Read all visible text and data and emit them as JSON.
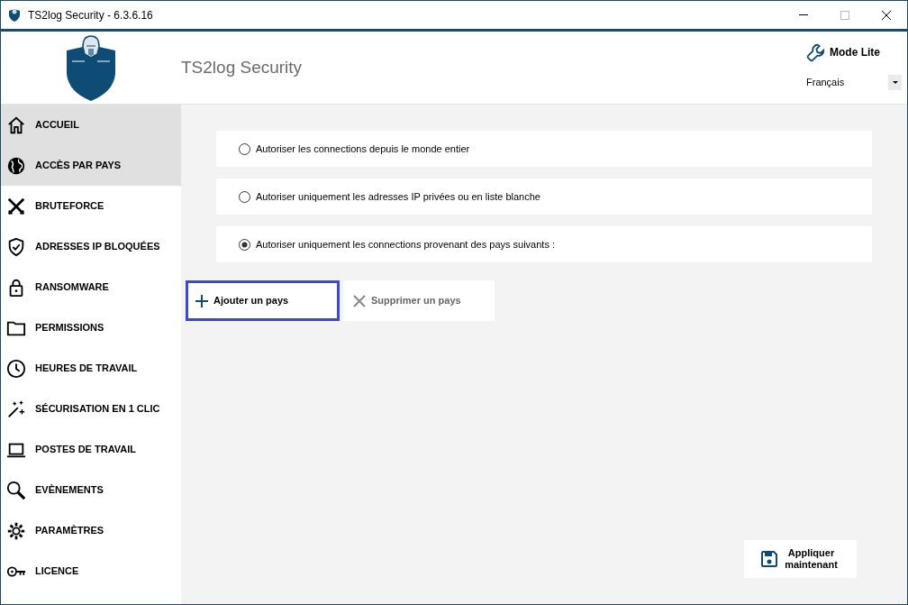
{
  "window": {
    "title": "TS2log Security - 6.3.6.16"
  },
  "header": {
    "app_name": "TS2log Security",
    "mode_button": "Mode Lite",
    "language": "Français"
  },
  "sidebar": {
    "items": [
      {
        "label": "ACCUEIL",
        "highlighted": true
      },
      {
        "label": "ACCÈS PAR PAYS",
        "highlighted": true
      },
      {
        "label": "BRUTEFORCE",
        "highlighted": false
      },
      {
        "label": "ADRESSES IP BLOQUÉES",
        "highlighted": false
      },
      {
        "label": "RANSOMWARE",
        "highlighted": false
      },
      {
        "label": "PERMISSIONS",
        "highlighted": false
      },
      {
        "label": "HEURES DE TRAVAIL",
        "highlighted": false
      },
      {
        "label": "SÉCURISATION EN 1 CLIC",
        "highlighted": false
      },
      {
        "label": "POSTES DE TRAVAIL",
        "highlighted": false
      },
      {
        "label": "EVÈNEMENTS",
        "highlighted": false
      },
      {
        "label": "PARAMÈTRES",
        "highlighted": false
      },
      {
        "label": "LICENCE",
        "highlighted": false
      }
    ]
  },
  "options": [
    {
      "label": "Autoriser les connections depuis le monde entier",
      "selected": false
    },
    {
      "label": "Autoriser uniquement les adresses IP privées ou en liste blanche",
      "selected": false
    },
    {
      "label": "Autoriser uniquement les connections provenant des pays suivants :",
      "selected": true
    }
  ],
  "actions": [
    {
      "label": "Ajouter un pays",
      "kind": "add",
      "focused": true,
      "disabled": false
    },
    {
      "label": "Supprimer un pays",
      "kind": "remove",
      "focused": false,
      "disabled": true
    }
  ],
  "apply_button": "Appliquer maintenant"
}
